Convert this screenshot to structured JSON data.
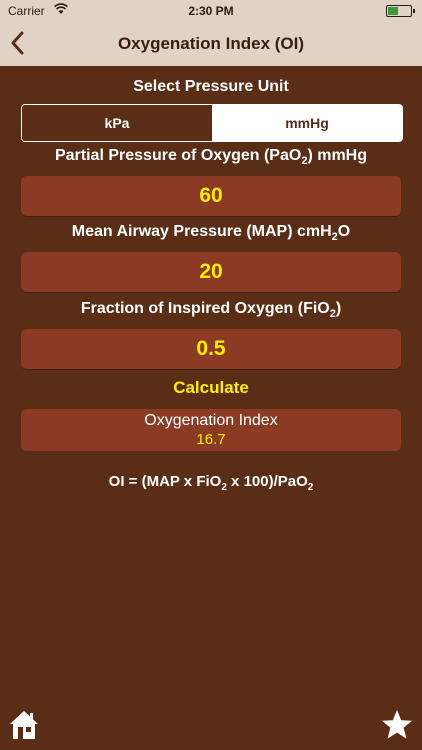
{
  "status_bar": {
    "carrier": "Carrier",
    "time": "2:30 PM"
  },
  "nav": {
    "title": "Oxygenation Index (OI)",
    "back_icon": "chevron-left-icon"
  },
  "unit_selector": {
    "label": "Select Pressure Unit",
    "options": [
      "kPa",
      "mmHg"
    ],
    "selected": "mmHg"
  },
  "pao2": {
    "label_main": "Partial Pressure of Oxygen (PaO",
    "label_sub": "2",
    "label_end": ") mmHg",
    "value": "60"
  },
  "map": {
    "label_main": "Mean Airway Pressure (MAP) cmH",
    "label_sub": "2",
    "label_end": "O",
    "value": "20"
  },
  "fio2": {
    "label_main": "Fraction of Inspired Oxygen (FiO",
    "label_sub": "2",
    "label_end": ")",
    "value": "0.5"
  },
  "calculate_label": "Calculate",
  "result": {
    "title": "Oxygenation Index",
    "value": "16.7"
  },
  "formula": {
    "part1": "OI = (MAP x FiO",
    "sub1": "2",
    "part2": " x 100)/PaO",
    "sub2": "2"
  },
  "colors": {
    "background": "#5a2e16",
    "field": "#8b3b24",
    "accent": "#ffee00",
    "nav_bar": "#e0d3c6"
  },
  "tab_icons": [
    "home-icon",
    "star-icon"
  ]
}
